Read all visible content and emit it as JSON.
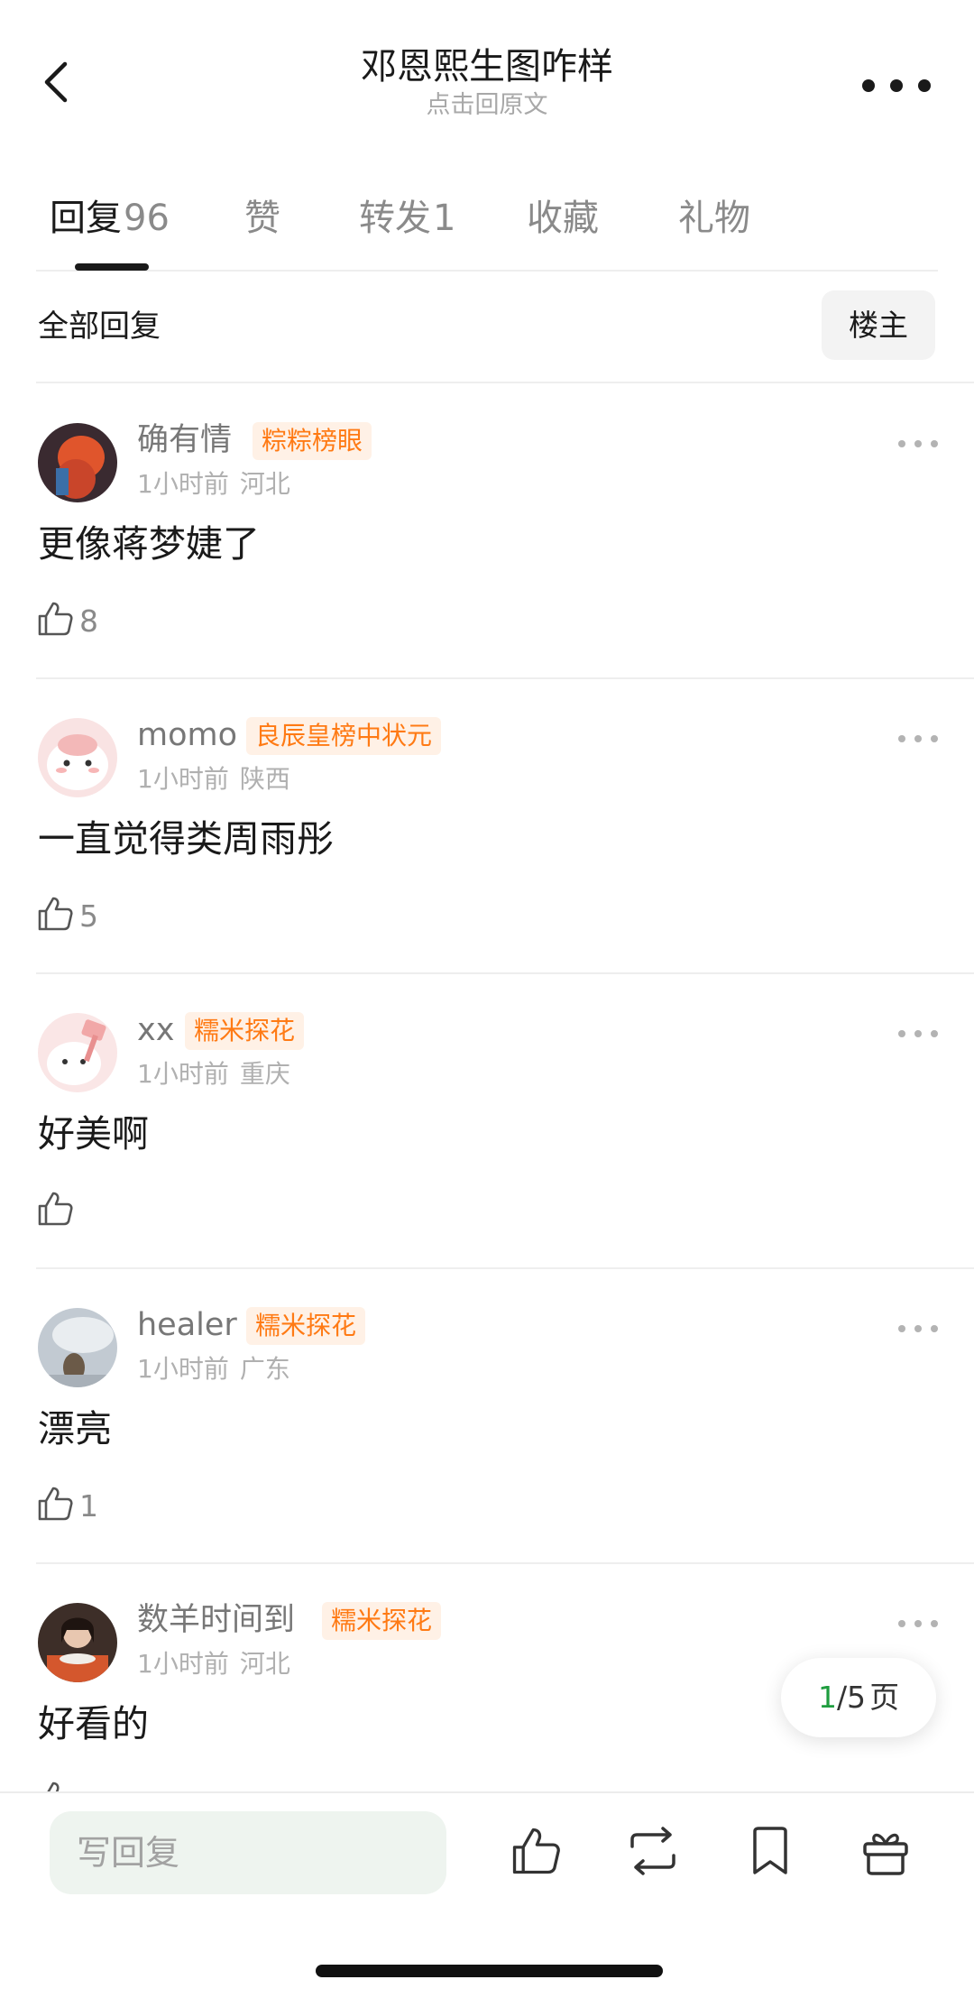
{
  "header": {
    "title": "邓恩熙生图咋样",
    "subtitle": "点击回原文"
  },
  "tabs": [
    {
      "label": "回复",
      "count": "96",
      "active": true
    },
    {
      "label": "赞",
      "count": ""
    },
    {
      "label": "转发",
      "count": "1"
    },
    {
      "label": "收藏",
      "count": ""
    },
    {
      "label": "礼物",
      "count": ""
    }
  ],
  "filter": {
    "all_replies": "全部回复",
    "owner_only": "楼主"
  },
  "comments": [
    {
      "username": "确有情",
      "badge": "粽粽榜眼",
      "time": "1小时前",
      "location": "河北",
      "text": "更像蒋梦婕了",
      "likes": "8",
      "avatar_color": "#5a3b35"
    },
    {
      "username": "momo",
      "badge": "良辰皇榜中状元",
      "time": "1小时前",
      "location": "陕西",
      "text": "一直觉得类周雨彤",
      "likes": "5",
      "avatar_color": "#f7d4d4"
    },
    {
      "username": "xx",
      "badge": "糯米探花",
      "time": "1小时前",
      "location": "重庆",
      "text": "好美啊",
      "likes": "",
      "avatar_color": "#f9dede"
    },
    {
      "username": "healer",
      "badge": "糯米探花",
      "time": "1小时前",
      "location": "广东",
      "text": "漂亮",
      "likes": "1",
      "avatar_color": "#c9d0d6"
    },
    {
      "username": "数羊时间到",
      "badge": "糯米探花",
      "time": "1小时前",
      "location": "河北",
      "text": "好看的",
      "likes": "",
      "avatar_color": "#4a3a32"
    }
  ],
  "pagination": {
    "current": "1",
    "total": "/5",
    "unit": "页"
  },
  "bottom_bar": {
    "reply_placeholder": "写回复"
  },
  "colors": {
    "badge_text": "#ff7a14",
    "badge_bg": "#fff1e6",
    "page_current": "#1f9d3f",
    "reply_input_bg": "#eef4ef"
  },
  "icons": [
    "back-arrow-icon",
    "more-icon",
    "thumbs-up-icon",
    "repost-icon",
    "bookmark-icon",
    "gift-icon"
  ]
}
